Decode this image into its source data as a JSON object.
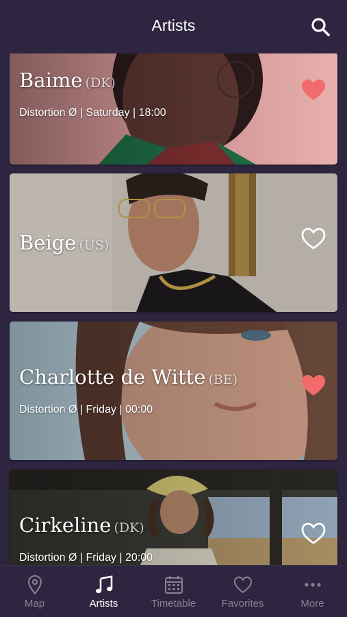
{
  "header": {
    "title": "Artists",
    "search_icon": "search-icon"
  },
  "artists": [
    {
      "name": "Baime",
      "country": "(DK)",
      "meta": "Distortion Ø | Saturday | 18:00",
      "favorite": true
    },
    {
      "name": "Beige",
      "country": "(US)",
      "meta": "",
      "favorite": false
    },
    {
      "name": "Charlotte de Witte",
      "country": "(BE)",
      "meta": "Distortion Ø | Friday | 00:00",
      "favorite": true
    },
    {
      "name": "Cirkeline",
      "country": "(DK)",
      "meta": "Distortion Ø | Friday | 20:00",
      "favorite": false
    }
  ],
  "tabs": [
    {
      "label": "Map",
      "icon": "map-pin-icon",
      "active": false
    },
    {
      "label": "Artists",
      "icon": "music-note-icon",
      "active": true
    },
    {
      "label": "Timetable",
      "icon": "calendar-icon",
      "active": false
    },
    {
      "label": "Favorites",
      "icon": "heart-icon",
      "active": false
    },
    {
      "label": "More",
      "icon": "more-dots-icon",
      "active": false
    }
  ],
  "colors": {
    "background": "#2e2540",
    "heart_filled": "#f26b6b",
    "tab_active": "#ffffff",
    "tab_inactive": "#8a8198"
  }
}
